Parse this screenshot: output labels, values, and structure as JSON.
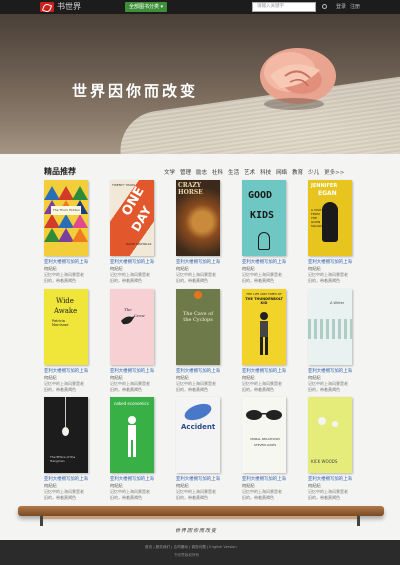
{
  "header": {
    "logo_text": "书世界",
    "category_button": "全部图书分类 ▾",
    "search_placeholder": "请输入关键字",
    "login": "登录",
    "register": "注册"
  },
  "banner": {
    "slogan": "世界因你而改变"
  },
  "section": {
    "title": "精品推荐",
    "categories": [
      "文学",
      "管理",
      "励志",
      "社科",
      "生活",
      "艺术",
      "科技",
      "网络",
      "教育",
      "少儿",
      "更多>>"
    ]
  },
  "books": [
    {
      "title": "亚利大楼拥写加的上海",
      "author": "何纪纪",
      "desc": "记忆中的上海风景是老",
      "desc2": "旧的，带着黄褐色"
    },
    {
      "title": "亚利大楼拥写加的上海",
      "author": "何纪纪",
      "desc": "记忆中的上海风景是老",
      "desc2": "旧的，带着黄褐色"
    },
    {
      "title": "亚利大楼拥写加的上海",
      "author": "何纪纪",
      "desc": "记忆中的上海风景是老",
      "desc2": "旧的，带着黄褐色"
    },
    {
      "title": "亚利大楼拥写加的上海",
      "author": "何纪纪",
      "desc": "记忆中的上海风景是老",
      "desc2": "旧的，带着黄褐色"
    },
    {
      "title": "亚利大楼拥写加的上海",
      "author": "何纪纪",
      "desc": "记忆中的上海风景是老",
      "desc2": "旧的，带着黄褐色"
    },
    {
      "title": "亚利大楼拥写加的上海",
      "author": "何纪纪",
      "desc": "记忆中的上海风景是老",
      "desc2": "旧的，带着黄褐色"
    },
    {
      "title": "亚利大楼拥写加的上海",
      "author": "何纪纪",
      "desc": "记忆中的上海风景是老",
      "desc2": "旧的，带着黄褐色"
    },
    {
      "title": "亚利大楼拥写加的上海",
      "author": "何纪纪",
      "desc": "记忆中的上海风景是老",
      "desc2": "旧的，带着黄褐色"
    },
    {
      "title": "亚利大楼拥写加的上海",
      "author": "何纪纪",
      "desc": "记忆中的上海风景是老",
      "desc2": "旧的，带着黄褐色"
    },
    {
      "title": "亚利大楼拥写加的上海",
      "author": "何纪纪",
      "desc": "记忆中的上海风景是老",
      "desc2": "旧的，带着黄褐色"
    },
    {
      "title": "亚利大楼拥写加的上海",
      "author": "何纪纪",
      "desc": "记忆中的上海风景是老",
      "desc2": "旧的，带着黄褐色"
    },
    {
      "title": "亚利大楼拥写加的上海",
      "author": "何纪纪",
      "desc": "记忆中的上海风景是老",
      "desc2": "旧的，带着黄褐色"
    },
    {
      "title": "亚利大楼拥写加的上海",
      "author": "何纪纪",
      "desc": "记忆中的上海风景是老",
      "desc2": "旧的，带着黄褐色"
    },
    {
      "title": "亚利大楼拥写加的上海",
      "author": "何纪纪",
      "desc": "记忆中的上海风景是老",
      "desc2": "旧的，带着黄褐色"
    },
    {
      "title": "亚利大楼拥写加的上海",
      "author": "何纪纪",
      "desc": "记忆中的上海风景是老",
      "desc2": "旧的，带着黄褐色"
    }
  ],
  "covers": {
    "c1": {
      "line1": "The Thorn Hidden"
    },
    "c2": {
      "line1": "TWENTY YEARS",
      "line2": "ONE",
      "line3": "DAY",
      "line4": "DAVID NICHOLLS"
    },
    "c3": {
      "line1": "CRAZY",
      "line2": "HORSE"
    },
    "c4": {
      "line1": "GOOD",
      "line2": "KIDS"
    },
    "c5": {
      "line1": "JENNIFER",
      "line2": "EGAN",
      "line3": "A VISIT FROM THE GOON SQUAD"
    },
    "c6": {
      "line1": "Wide",
      "line2": "Awake",
      "line3": "Patricia Morrisroe"
    },
    "c7": {
      "line1": "The",
      "line2": "Crow"
    },
    "c8": {
      "line1": "The Cave of the Cyclops"
    },
    "c9": {
      "line1": "THE LIFE AND TIMES OF",
      "line2": "THE THUNDERBOLT KID"
    },
    "c10": {
      "line1": "A Writer"
    },
    "c11": {
      "line1": "The Ethics of the Hangman"
    },
    "c12": {
      "line1": "naked economics"
    },
    "c13": {
      "line1": "Accident"
    },
    "c14": {
      "line1": "MORAL RELATIVISM",
      "line2": "STEVEN LUKES"
    },
    "c15": {
      "line1": "KICK WOODS"
    }
  },
  "shelf_motto": "世界因你而改变",
  "footer": {
    "links": "首页 | 服务我们 | 合同撤动 | 调查问题 | English Version",
    "copyright": "书世界版权所有"
  },
  "colors": {
    "accent_green": "#3f8f3a",
    "link_blue": "#2a5db0",
    "logo_red": "#c8211b"
  }
}
